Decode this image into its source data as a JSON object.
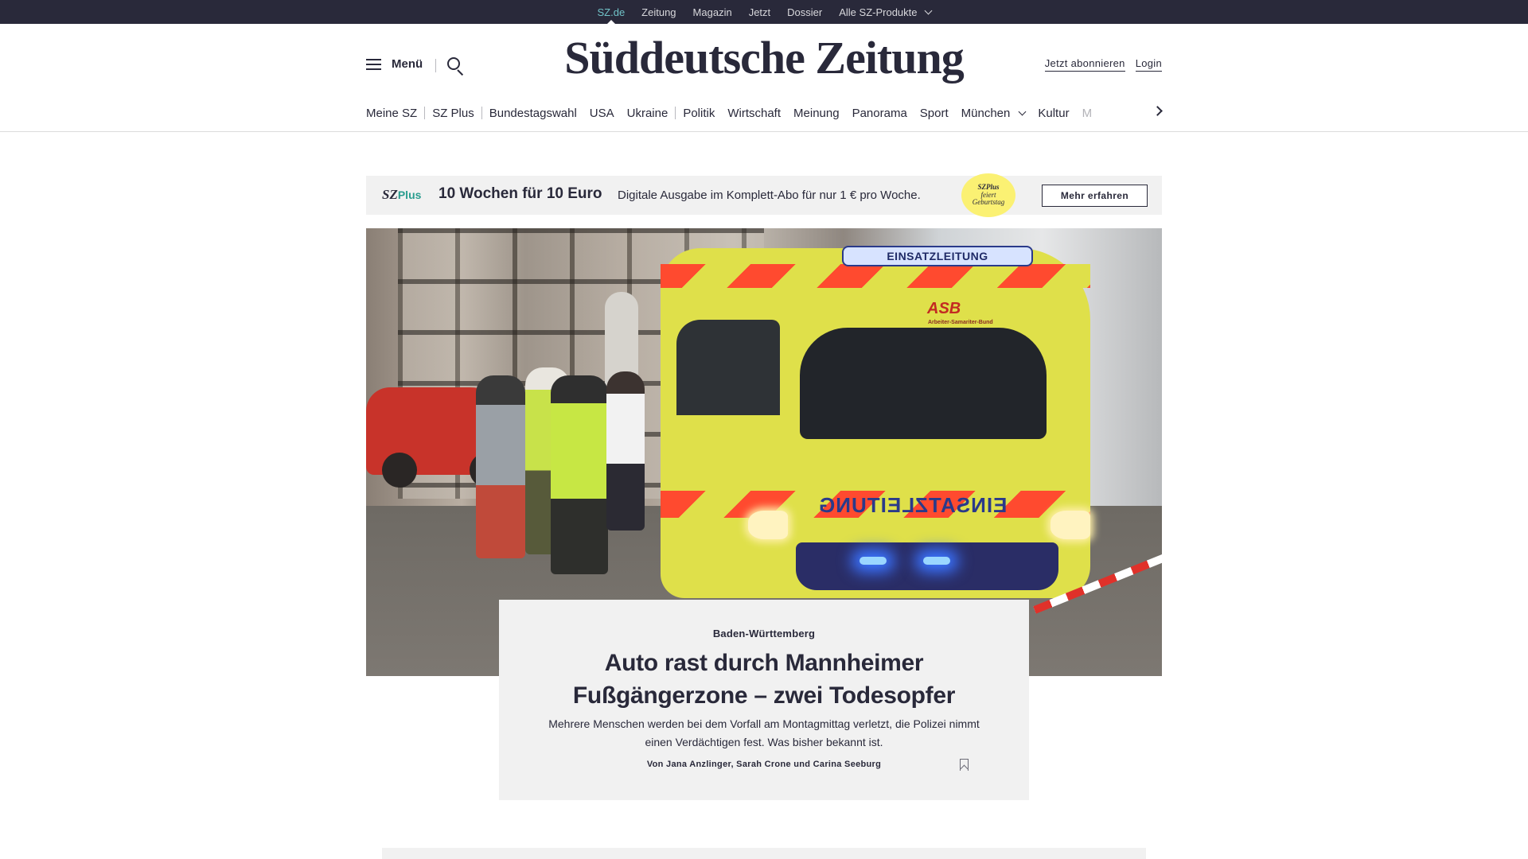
{
  "topbar": {
    "items": [
      {
        "label": "SZ.de",
        "active": true
      },
      {
        "label": "Zeitung"
      },
      {
        "label": "Magazin"
      },
      {
        "label": "Jetzt"
      },
      {
        "label": "Dossier"
      },
      {
        "label": "Alle SZ-Produkte",
        "has_dropdown": true
      }
    ]
  },
  "header": {
    "menu_label": "Menü",
    "logo": "Süddeutsche Zeitung",
    "subscribe_label": "Jetzt abonnieren",
    "login_label": "Login",
    "nav": [
      "Meine SZ",
      "SZ Plus",
      "Bundestagswahl",
      "USA",
      "Ukraine",
      "Politik",
      "Wirtschaft",
      "Meinung",
      "Panorama",
      "Sport",
      "München",
      "Kultur",
      "M"
    ]
  },
  "promo": {
    "logo": "SZ",
    "logo_plus": "Plus",
    "headline": "10 Wochen für 10 Euro",
    "text": "Digitale Ausgabe im Komplett-Abo für nur 1 € pro Woche.",
    "badge_line1": "SZPlus",
    "badge_line2": "feiert",
    "badge_line3": "Geburtstag",
    "button": "Mehr erfahren"
  },
  "hero": {
    "lightbar_text": "EINSATZLEITUNG",
    "asb_text": "ASB",
    "asb_subtext": "Arbeiter-Samariter-Bund",
    "side_text": "EINSATZLEITUNG"
  },
  "teaser": {
    "kicker": "Baden-Württemberg",
    "headline_line1": "Auto rast durch Mannheimer",
    "headline_line2": "Fußgängerzone – zwei Todesopfer",
    "summary": "Mehrere Menschen werden bei dem Vorfall am Montagmittag verletzt, die Polizei nimmt einen Verdächtigen fest. Was bisher bekannt ist.",
    "byline": "Von Jana Anzlinger, Sarah Crone und Carina Seeburg"
  },
  "colors": {
    "dark": "#29293a",
    "accent_teal": "#71c3c8",
    "teaser_bg": "#f1f1f1",
    "badge_yellow": "#fbf173"
  }
}
